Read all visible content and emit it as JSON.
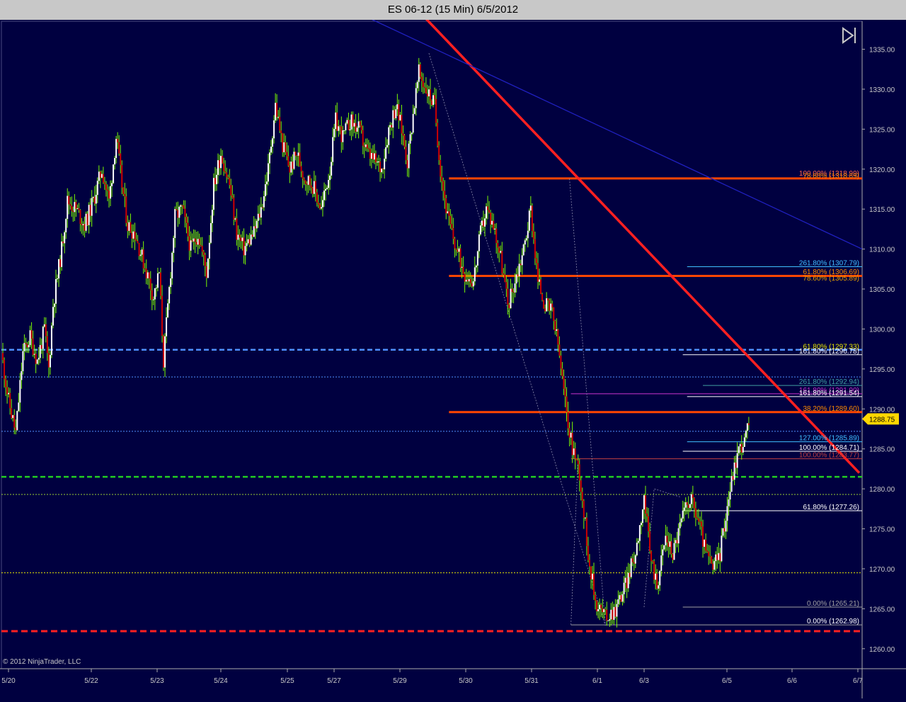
{
  "window": {
    "title": "ES 06-12 (15 Min)  6/5/2012"
  },
  "copyright": "© 2012 NinjaTrader, LLC",
  "toolbar": {
    "icon": "play-pause-icon"
  },
  "colors": {
    "background": "#000040",
    "up": "#ffffff",
    "down": "#cc0000",
    "wick": "#7cfc00",
    "price_badge": "#ffd700"
  },
  "chart_data": {
    "type": "candlestick",
    "instrument": "ES 06-12",
    "interval": "15 Min",
    "ylim": [
      1257.5,
      1338.5
    ],
    "y_ticks": [
      1260,
      1265,
      1270,
      1275,
      1280,
      1285,
      1290,
      1295,
      1300,
      1305,
      1310,
      1315,
      1320,
      1325,
      1330,
      1335
    ],
    "x_ticks": [
      "5/20",
      "5/22",
      "5/23",
      "5/24",
      "5/25",
      "5/27",
      "5/29",
      "5/30",
      "5/31",
      "6/1",
      "6/3",
      "6/5",
      "6/6",
      "6/7"
    ],
    "last_price": "1288.75",
    "price_path": [
      [
        0,
        1297
      ],
      [
        0.5,
        1291
      ],
      [
        1,
        1287
      ],
      [
        1.5,
        1297
      ],
      [
        2,
        1299
      ],
      [
        2.5,
        1296
      ],
      [
        3,
        1300
      ],
      [
        3.3,
        1295
      ],
      [
        3.6,
        1303
      ],
      [
        4.2,
        1310
      ],
      [
        4.6,
        1316
      ],
      [
        5.2,
        1315
      ],
      [
        5.8,
        1313
      ],
      [
        6.4,
        1316
      ],
      [
        7,
        1320
      ],
      [
        7.5,
        1316
      ],
      [
        8,
        1324
      ],
      [
        8.4,
        1318
      ],
      [
        8.8,
        1313
      ],
      [
        9.3,
        1312
      ],
      [
        9.8,
        1309
      ],
      [
        10.3,
        1306
      ],
      [
        10.6,
        1304
      ],
      [
        11,
        1307
      ],
      [
        11.3,
        1296
      ],
      [
        11.7,
        1305
      ],
      [
        12.1,
        1314
      ],
      [
        12.6,
        1315
      ],
      [
        13.2,
        1310
      ],
      [
        13.7,
        1312
      ],
      [
        14.3,
        1307
      ],
      [
        14.8,
        1318
      ],
      [
        15.3,
        1322
      ],
      [
        15.9,
        1318
      ],
      [
        16.4,
        1312
      ],
      [
        16.9,
        1310
      ],
      [
        17.6,
        1312
      ],
      [
        18.1,
        1315
      ],
      [
        18.6,
        1320
      ],
      [
        19.1,
        1328
      ],
      [
        19.6,
        1323
      ],
      [
        20.1,
        1320
      ],
      [
        20.6,
        1322
      ],
      [
        21.1,
        1319
      ],
      [
        21.7,
        1318
      ],
      [
        22.3,
        1315
      ],
      [
        22.9,
        1320
      ],
      [
        23.3,
        1326
      ],
      [
        23.8,
        1324
      ],
      [
        24.3,
        1326
      ],
      [
        24.9,
        1325
      ],
      [
        25.5,
        1322
      ],
      [
        26,
        1321
      ],
      [
        26.5,
        1320
      ],
      [
        27,
        1325
      ],
      [
        27.5,
        1328
      ],
      [
        27.9,
        1325
      ],
      [
        28.3,
        1321
      ],
      [
        28.7,
        1327
      ],
      [
        29.1,
        1332
      ],
      [
        29.6,
        1330
      ],
      [
        30.2,
        1328
      ],
      [
        30.6,
        1320
      ],
      [
        31.1,
        1314
      ],
      [
        31.7,
        1310
      ],
      [
        32.3,
        1307
      ],
      [
        32.9,
        1306
      ],
      [
        33.4,
        1312
      ],
      [
        33.8,
        1315
      ],
      [
        34.3,
        1313
      ],
      [
        34.8,
        1309
      ],
      [
        35.3,
        1303
      ],
      [
        35.8,
        1306
      ],
      [
        36.4,
        1310
      ],
      [
        36.9,
        1315
      ],
      [
        37.4,
        1306
      ],
      [
        37.9,
        1303
      ],
      [
        38.4,
        1302
      ],
      [
        38.8,
        1298
      ],
      [
        39.2,
        1292
      ],
      [
        39.7,
        1286
      ],
      [
        40.3,
        1282
      ],
      [
        40.9,
        1272
      ],
      [
        41.4,
        1266
      ],
      [
        42.1,
        1264
      ],
      [
        42.8,
        1265
      ],
      [
        43.5,
        1268
      ],
      [
        44.2,
        1272
      ],
      [
        44.8,
        1279
      ],
      [
        45.2,
        1272
      ],
      [
        45.7,
        1268
      ],
      [
        46.3,
        1274
      ],
      [
        46.8,
        1272
      ],
      [
        47.4,
        1276
      ],
      [
        48,
        1279
      ],
      [
        48.6,
        1276
      ],
      [
        49.1,
        1272
      ],
      [
        49.6,
        1270
      ],
      [
        50.1,
        1272
      ],
      [
        50.6,
        1278
      ],
      [
        51,
        1282
      ],
      [
        51.4,
        1285
      ],
      [
        51.8,
        1286
      ],
      [
        52.2,
        1288.75
      ]
    ],
    "trend_lines": [
      {
        "name": "red-trendline",
        "color": "#ff2020",
        "width": 3.5,
        "p1": [
          29.5,
          1339
        ],
        "p2": [
          59.8,
          1282
        ]
      },
      {
        "name": "blue-trendline",
        "color": "#2020c0",
        "width": 1.3,
        "p1": [
          25.5,
          1339
        ],
        "p2": [
          60,
          1310
        ]
      }
    ],
    "horizontal_lines": [
      {
        "y": 1318.84,
        "x_from": 31.2,
        "color": "#ff4500",
        "width": 3,
        "dash": ""
      },
      {
        "y": 1306.64,
        "x_from": 31.2,
        "color": "#ff4500",
        "width": 3,
        "dash": ""
      },
      {
        "y": 1289.6,
        "x_from": 31.2,
        "color": "#ff4500",
        "width": 3,
        "dash": ""
      },
      {
        "y": 1297.4,
        "x_from": 0,
        "color": "#4f8fff",
        "width": 2.5,
        "dash": "7,4"
      },
      {
        "y": 1294.0,
        "x_from": 0,
        "color": "#4f8fff",
        "width": 1,
        "dash": "2,2"
      },
      {
        "y": 1287.2,
        "x_from": 0,
        "color": "#4f8fff",
        "width": 1,
        "dash": "2,2"
      },
      {
        "y": 1281.5,
        "x_from": 0,
        "color": "#22cc22",
        "width": 2.5,
        "dash": "7,4"
      },
      {
        "y": 1279.3,
        "x_from": 0,
        "color": "#9acd32",
        "width": 1,
        "dash": "2,2"
      },
      {
        "y": 1269.5,
        "x_from": 0,
        "color": "#e6e600",
        "width": 1,
        "dash": "2,2"
      },
      {
        "y": 1262.2,
        "x_from": 0,
        "color": "#ff2020",
        "width": 3,
        "dash": "9,5"
      },
      {
        "y": 1307.79,
        "x_from": 47.8,
        "color": "#40c0ff",
        "width": 1,
        "dash": ""
      },
      {
        "y": 1296.78,
        "x_from": 47.5,
        "color": "#ffffff",
        "width": 1,
        "dash": ""
      },
      {
        "y": 1292.94,
        "x_from": 48.9,
        "color": "#40a0a0",
        "width": 1,
        "dash": ""
      },
      {
        "y": 1291.54,
        "x_from": 47.8,
        "color": "#ffffff",
        "width": 1,
        "dash": ""
      },
      {
        "y": 1291.9,
        "x_from": 39.7,
        "color": "#cc33cc",
        "width": 1,
        "dash": ""
      },
      {
        "y": 1285.89,
        "x_from": 47.8,
        "color": "#40c0ff",
        "width": 1,
        "dash": ""
      },
      {
        "y": 1284.71,
        "x_from": 47.5,
        "color": "#ffffff",
        "width": 1,
        "dash": ""
      },
      {
        "y": 1283.77,
        "x_from": 39.7,
        "color": "#c04040",
        "width": 1,
        "dash": ""
      },
      {
        "y": 1277.26,
        "x_from": 47.5,
        "color": "#ffffff",
        "width": 1,
        "dash": ""
      },
      {
        "y": 1265.21,
        "x_from": 47.5,
        "color": "#a0a0a0",
        "width": 1,
        "dash": ""
      },
      {
        "y": 1262.98,
        "x_from": 39.7,
        "color": "#a0a0a0",
        "width": 1,
        "dash": ""
      }
    ],
    "fib_labels": [
      {
        "text": "100.00% (1318.99)",
        "y": 1318.99,
        "color": "#ff6347"
      },
      {
        "text": "78.60% (1318.69)",
        "y": 1318.69,
        "color": "#ff8c00"
      },
      {
        "text": "261.80% (1307.79)",
        "y": 1307.79,
        "color": "#40c0ff"
      },
      {
        "text": "61.80% (1306.69)",
        "y": 1306.69,
        "color": "#ff8c00"
      },
      {
        "text": "78.60% (1305.89)",
        "y": 1305.89,
        "color": "#e6a000"
      },
      {
        "text": "61.80% (1297.33)",
        "y": 1297.33,
        "color": "#e6e600"
      },
      {
        "text": "161.80% (1296.78)",
        "y": 1296.78,
        "color": "#ffffff"
      },
      {
        "text": "261.80% (1292.94)",
        "y": 1292.94,
        "color": "#40a0a0"
      },
      {
        "text": "161.80% (1291.90)",
        "y": 1291.9,
        "color": "#cc33cc"
      },
      {
        "text": "161.80% (1291.54)",
        "y": 1291.54,
        "color": "#ffffff"
      },
      {
        "text": "38.20% (1289.60)",
        "y": 1289.6,
        "color": "#ff8c00"
      },
      {
        "text": "127.00% (1285.89)",
        "y": 1285.89,
        "color": "#40c0ff"
      },
      {
        "text": "100.00% (1284.71)",
        "y": 1284.71,
        "color": "#ffffff"
      },
      {
        "text": "100.00% (1283.77)",
        "y": 1283.77,
        "color": "#c04040"
      },
      {
        "text": "61.80% (1277.26)",
        "y": 1277.26,
        "color": "#ffffff"
      },
      {
        "text": "0.00% (1265.21)",
        "y": 1265.21,
        "color": "#a0a0a0"
      },
      {
        "text": "0.00% (1262.98)",
        "y": 1262.98,
        "color": "#ffffff"
      }
    ],
    "fib_connectors": [
      {
        "points": [
          [
            29.8,
            1334.5
          ],
          [
            42.1,
            1262.9
          ]
        ],
        "color": "#8888aa"
      },
      {
        "points": [
          [
            39.6,
            1318.8
          ],
          [
            42.1,
            1262.9
          ]
        ],
        "color": "#8888aa"
      },
      {
        "points": [
          [
            39.7,
            1263
          ],
          [
            40.2,
            1284
          ]
        ],
        "color": "#8888aa"
      },
      {
        "points": [
          [
            44.8,
            1265.2
          ],
          [
            45.5,
            1280
          ],
          [
            47.3,
            1279
          ]
        ],
        "color": "#8888aa"
      }
    ]
  }
}
